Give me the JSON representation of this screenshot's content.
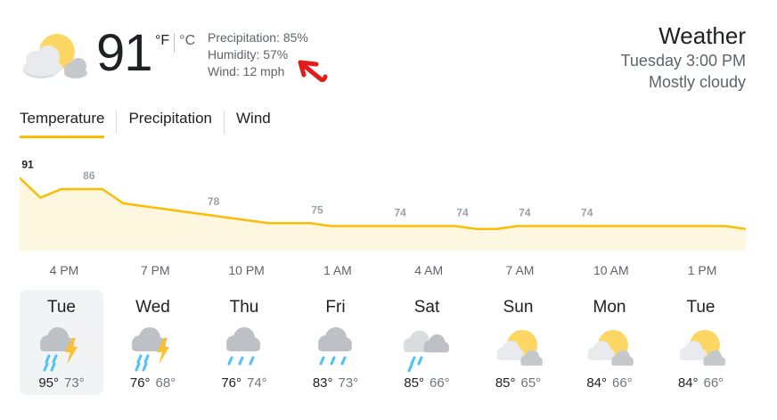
{
  "current": {
    "temp": "91",
    "unit_f": "°F",
    "unit_c": "°C",
    "precipitation": "Precipitation: 85%",
    "humidity": "Humidity: 57%",
    "wind": "Wind: 12 mph",
    "icon": "partly-cloudy-icon"
  },
  "header": {
    "title": "Weather",
    "datetime": "Tuesday 3:00 PM",
    "condition": "Mostly cloudy"
  },
  "tabs": [
    {
      "label": "Temperature",
      "active": true
    },
    {
      "label": "Precipitation",
      "active": false
    },
    {
      "label": "Wind",
      "active": false
    }
  ],
  "colors": {
    "accent": "#fbbc04",
    "fill": "#fef7e0",
    "rain": "#4fc3f7",
    "bolt": "#fbc02d",
    "sun": "#fdd663",
    "cloud": "#c6c9cc",
    "annotation": "#e21b1b"
  },
  "chart_data": {
    "type": "area",
    "values": [
      91,
      84,
      87,
      87,
      87,
      82,
      81,
      80,
      79,
      78,
      77,
      76,
      75,
      75,
      75,
      74,
      74,
      74,
      74,
      74,
      74,
      74,
      73,
      73,
      74,
      74,
      74,
      74,
      74,
      74,
      74,
      74,
      74,
      74,
      74,
      73
    ],
    "labels": [
      {
        "text": "91",
        "index": 0,
        "bold": true
      },
      {
        "text": "86",
        "index": 3
      },
      {
        "text": "78",
        "index": 9
      },
      {
        "text": "75",
        "index": 14
      },
      {
        "text": "74",
        "index": 18
      },
      {
        "text": "74",
        "index": 21
      },
      {
        "text": "74",
        "index": 24
      },
      {
        "text": "74",
        "index": 27
      }
    ],
    "x_ticks": [
      "4 PM",
      "7 PM",
      "10 PM",
      "1 AM",
      "4 AM",
      "7 AM",
      "10 AM",
      "1 PM"
    ]
  },
  "forecast": [
    {
      "day": "Tue",
      "hi": "95°",
      "lo": "73°",
      "icon": "thunderstorm-rain-icon",
      "selected": true
    },
    {
      "day": "Wed",
      "hi": "76°",
      "lo": "68°",
      "icon": "thunderstorm-rain-icon",
      "selected": false
    },
    {
      "day": "Thu",
      "hi": "76°",
      "lo": "74°",
      "icon": "rain-icon",
      "selected": false
    },
    {
      "day": "Fri",
      "hi": "83°",
      "lo": "73°",
      "icon": "rain-icon",
      "selected": false
    },
    {
      "day": "Sat",
      "hi": "85°",
      "lo": "66°",
      "icon": "scattered-showers-icon",
      "selected": false
    },
    {
      "day": "Sun",
      "hi": "85°",
      "lo": "65°",
      "icon": "partly-cloudy-icon",
      "selected": false
    },
    {
      "day": "Mon",
      "hi": "84°",
      "lo": "66°",
      "icon": "partly-cloudy-icon",
      "selected": false
    },
    {
      "day": "Tue",
      "hi": "84°",
      "lo": "66°",
      "icon": "partly-cloudy-icon",
      "selected": false
    }
  ]
}
